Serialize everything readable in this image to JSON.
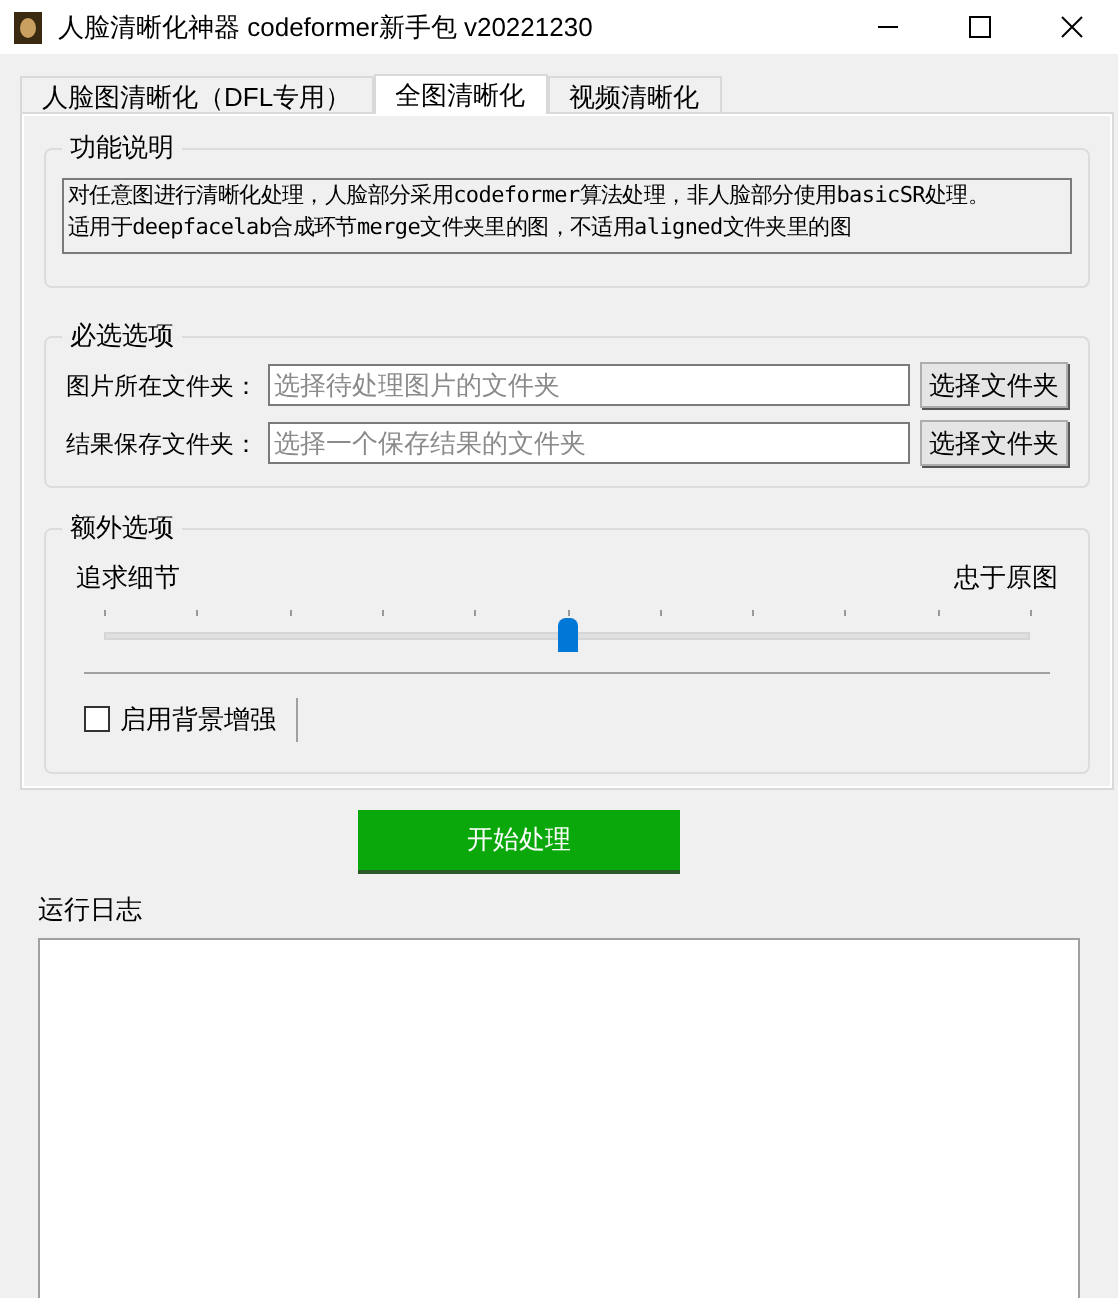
{
  "window": {
    "title": "人脸清晰化神器 codeformer新手包 v20221230"
  },
  "tabs": [
    {
      "label": "人脸图清晰化（DFL专用）",
      "selected": false
    },
    {
      "label": "全图清晰化",
      "selected": true
    },
    {
      "label": "视频清晰化",
      "selected": false
    }
  ],
  "description": {
    "title": "功能说明",
    "lines": [
      "对任意图进行清晰化处理，人脸部分采用codeformer算法处理，非人脸部分使用basicSR处理。",
      "适用于deepfacelab合成环节merge文件夹里的图，不适用aligned文件夹里的图"
    ]
  },
  "required": {
    "title": "必选选项",
    "rows": [
      {
        "label": "图片所在文件夹：",
        "placeholder": "选择待处理图片的文件夹",
        "button": "选择文件夹"
      },
      {
        "label": "结果保存文件夹：",
        "placeholder": "选择一个保存结果的文件夹",
        "button": "选择文件夹"
      }
    ]
  },
  "extra": {
    "title": "额外选项",
    "slider": {
      "left_label": "追求细节",
      "right_label": "忠于原图",
      "level": 0.5
    },
    "checkbox": {
      "label": "启用背景增强",
      "checked": false
    }
  },
  "start_button": "开始处理",
  "log": {
    "title": "运行日志"
  }
}
